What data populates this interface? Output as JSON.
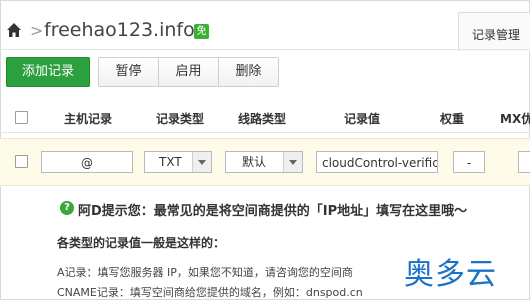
{
  "header": {
    "domain": "freehao123.info",
    "separator": ">",
    "badge": "免",
    "tab_label": "记录管理"
  },
  "toolbar": {
    "add_label": "添加记录",
    "buttons": [
      "暂停",
      "启用",
      "删除"
    ]
  },
  "table": {
    "columns": [
      "主机记录",
      "记录类型",
      "线路类型",
      "记录值",
      "权重",
      "MX优"
    ]
  },
  "row": {
    "host_value": "@",
    "type_value": "TXT",
    "line_value": "默认",
    "record_value": "cloudControl-verifica",
    "weight_value": "-"
  },
  "hint": {
    "icon": "?",
    "title": "阿D提示您：最常见的是将空间商提供的「IP地址」填写在这里哦～",
    "subtitle": "各类型的记录值一般是这样的：",
    "lines": [
      "A记录：填写您服务器 IP，如果您不知道，请咨询您的空间商",
      "CNAME记录：填写空间商给您提供的域名，例如：dnspod.cn"
    ]
  },
  "watermark": "奥多云",
  "colors": {
    "accent_green": "#2c9f3f",
    "row_highlight": "#fffbe9",
    "watermark_blue": "#1a73c9"
  }
}
